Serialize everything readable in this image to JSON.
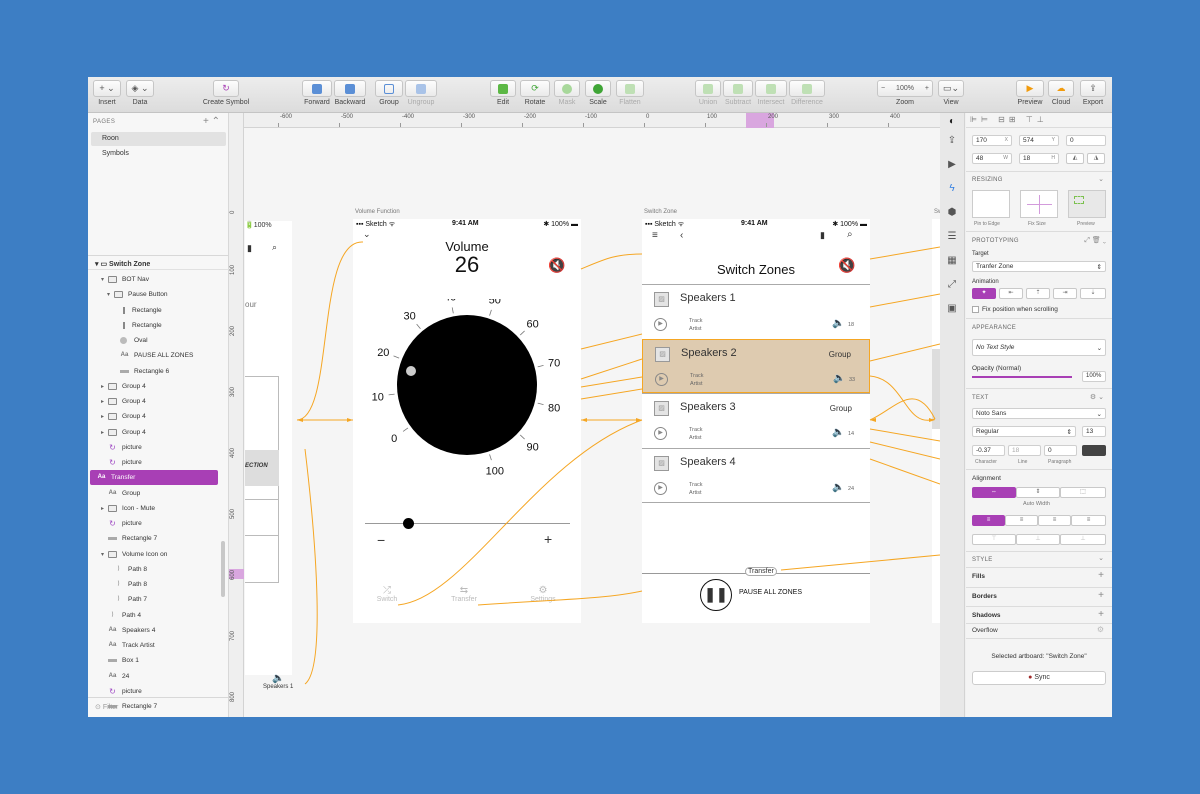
{
  "toolbar": {
    "insert": "Insert",
    "data": "Data",
    "create_symbol": "Create Symbol",
    "forward": "Forward",
    "backward": "Backward",
    "group": "Group",
    "ungroup": "Ungroup",
    "edit": "Edit",
    "rotate": "Rotate",
    "mask": "Mask",
    "scale": "Scale",
    "flatten": "Flatten",
    "union": "Union",
    "subtract": "Subtract",
    "intersect": "Intersect",
    "difference": "Difference",
    "zoom_label": "Zoom",
    "zoom_value": "100%",
    "view": "View",
    "preview": "Preview",
    "cloud": "Cloud",
    "export": "Export"
  },
  "pages": {
    "header": "PAGES",
    "items": [
      "Roon",
      "Symbols"
    ]
  },
  "layers": {
    "artboard": "Switch Zone",
    "items": [
      {
        "label": "BOT Nav",
        "icon": "folder"
      },
      {
        "label": "Pause Button",
        "icon": "folder"
      },
      {
        "label": "Rectangle",
        "icon": "line"
      },
      {
        "label": "Rectangle",
        "icon": "line"
      },
      {
        "label": "Oval",
        "icon": "oval"
      },
      {
        "label": "PAUSE ALL ZONES",
        "icon": "text"
      },
      {
        "label": "Rectangle 6",
        "icon": "rect"
      },
      {
        "label": "Group 4",
        "icon": "folder"
      },
      {
        "label": "Group 4",
        "icon": "folder"
      },
      {
        "label": "Group 4",
        "icon": "folder"
      },
      {
        "label": "Group 4",
        "icon": "folder"
      },
      {
        "label": "picture",
        "icon": "symbol"
      },
      {
        "label": "picture",
        "icon": "symbol"
      },
      {
        "label": "Transfer",
        "icon": "text"
      },
      {
        "label": "Group",
        "icon": "text"
      },
      {
        "label": "Icon - Mute",
        "icon": "folder"
      },
      {
        "label": "picture",
        "icon": "symbol"
      },
      {
        "label": "Rectangle 7",
        "icon": "rect"
      },
      {
        "label": "Volume Icon on",
        "icon": "folder"
      },
      {
        "label": "Path 8",
        "icon": "path"
      },
      {
        "label": "Path 8",
        "icon": "path"
      },
      {
        "label": "Path 7",
        "icon": "path"
      },
      {
        "label": "Path 4",
        "icon": "path"
      },
      {
        "label": "Speakers 4",
        "icon": "text"
      },
      {
        "label": "Track Artist",
        "icon": "text"
      },
      {
        "label": "Box 1",
        "icon": "rect"
      },
      {
        "label": "24",
        "icon": "text"
      },
      {
        "label": "picture",
        "icon": "symbol"
      },
      {
        "label": "Rectangle 7",
        "icon": "rect"
      },
      {
        "label": "Volume Icon on",
        "icon": "folder"
      }
    ],
    "filter": "Filter"
  },
  "rulers": {
    "h": [
      "-600",
      "-500",
      "-400",
      "-300",
      "-200",
      "-100",
      "0",
      "100",
      "200",
      "300",
      "400"
    ],
    "v": [
      "0",
      "100",
      "200",
      "300",
      "400",
      "500",
      "600",
      "700",
      "800"
    ]
  },
  "status_bar": {
    "carrier": "Sketch",
    "time": "9:41 AM",
    "battery": "100%"
  },
  "artboard_left": {
    "text_our": "our",
    "text_ection": "ECTION",
    "speakers_label": "Speakers 1"
  },
  "volume_ab": {
    "label": "Volume Function",
    "title": "Volume",
    "value": "26",
    "dial_ticks": [
      "0",
      "10",
      "20",
      "30",
      "40",
      "50",
      "60",
      "70",
      "80",
      "90",
      "100"
    ],
    "minus": "−",
    "plus": "+",
    "tabs": [
      "Switch",
      "Transfer",
      "Settings"
    ]
  },
  "zone_ab": {
    "label": "Switch Zone",
    "title": "Switch Zones",
    "rows": [
      {
        "name": "Speakers 1",
        "group": "",
        "track": "Track",
        "artist": "Artist",
        "vol": "18"
      },
      {
        "name": "Speakers 2",
        "group": "Group",
        "track": "Track",
        "artist": "Artist",
        "vol": "33"
      },
      {
        "name": "Speakers 3",
        "group": "Group",
        "track": "Track",
        "artist": "Artist",
        "vol": "14"
      },
      {
        "name": "Speakers 4",
        "group": "",
        "track": "Track",
        "artist": "Artist",
        "vol": "24"
      }
    ],
    "transfer": "Transfer",
    "pause_label": "PAUSE ALL ZONES"
  },
  "inspector": {
    "x": "170",
    "y": "574",
    "rot": "0",
    "w": "48",
    "h": "18",
    "lbl_x": "X",
    "lbl_y": "Y",
    "lbl_w": "W",
    "lbl_h": "H",
    "resizing": "RESIZING",
    "pin_edge": "Pin to Edge",
    "fix_size": "Fix Size",
    "preview": "Preview",
    "prototyping": "PROTOTYPING",
    "target": "Target",
    "target_value": "Tranfer Zone",
    "animation": "Animation",
    "fix_position": "Fix position when scrolling",
    "appearance": "APPEARANCE",
    "text_style": "No Text Style",
    "opacity": "Opacity (Normal)",
    "opacity_value": "100%",
    "text": "TEXT",
    "font": "Noto Sans",
    "weight": "Regular",
    "size": "13",
    "char": "-0.37",
    "line": "18",
    "para": "0",
    "char_lbl": "Character",
    "line_lbl": "Line",
    "para_lbl": "Paragraph",
    "alignment": "Alignment",
    "auto_width": "Auto Width",
    "style": "STYLE",
    "fills": "Fills",
    "borders": "Borders",
    "shadows": "Shadows",
    "overflow": "Overflow",
    "selected": "Selected artboard: \"Switch Zone\"",
    "sync": "Sync"
  },
  "colors": {
    "accent": "#a83fb5",
    "link": "#f5a623",
    "highlight": "#decbb0",
    "highlight_border": "#f5a623",
    "background": "#3d7ec4"
  }
}
